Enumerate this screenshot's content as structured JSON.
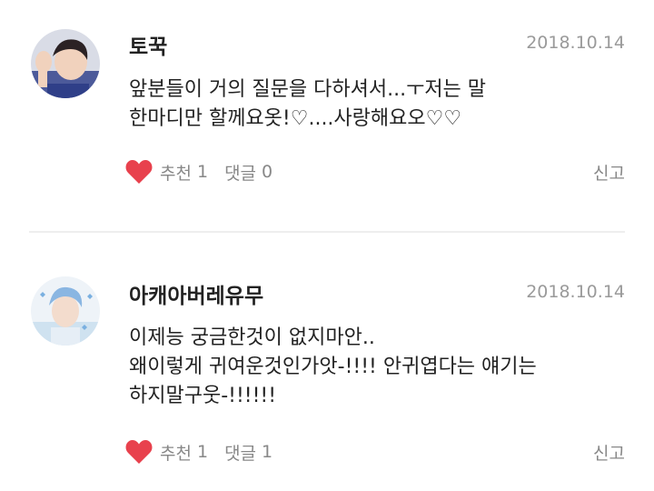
{
  "comments": [
    {
      "username": "토꾹",
      "date": "2018.10.14",
      "lines": [
        "앞분들이 거의 질문을 다하셔서...ㅜ저는 말",
        "한마디만 할께요옷!♡....사랑해요오♡♡"
      ],
      "like_label": "추천",
      "like_count": "1",
      "reply_label": "댓글",
      "reply_count": "0",
      "report_label": "신고",
      "avatar_icon": "avatar-photo-waving-person"
    },
    {
      "username": "아캐아버레유무",
      "date": "2018.10.14",
      "lines": [
        "이제능 궁금한것이 없지마안..",
        "왜이렇게 귀여운것인가앗-!!!! 안귀엽다는 얘기는",
        "하지말구웃-!!!!!!"
      ],
      "like_label": "추천",
      "like_count": "1",
      "reply_label": "댓글",
      "reply_count": "1",
      "report_label": "신고",
      "avatar_icon": "avatar-photo-blue-hair-person"
    }
  ],
  "colors": {
    "heart": "#e8414d",
    "date_text": "#9a9a9a",
    "meta_text": "#888888",
    "divider": "#eeeeee"
  }
}
